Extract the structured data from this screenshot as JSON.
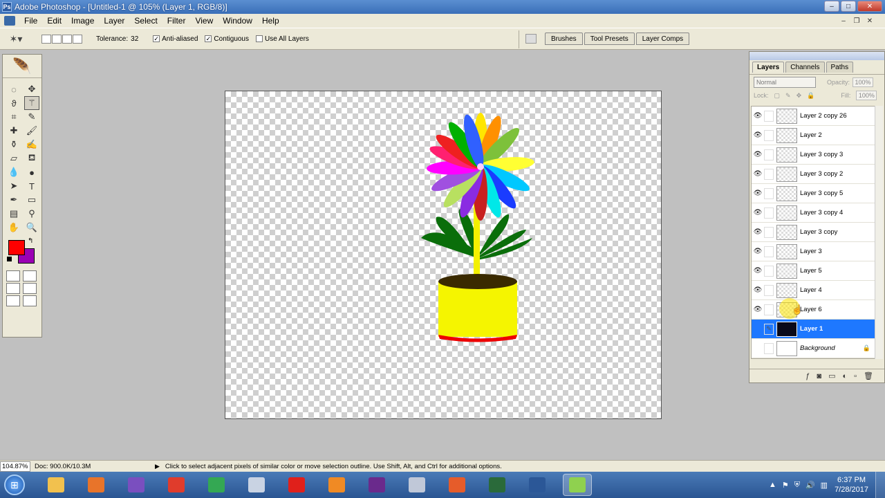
{
  "window": {
    "title": "Adobe Photoshop - [Untitled-1 @ 105% (Layer 1, RGB/8)]",
    "controls": {
      "minimize": "–",
      "maximize": "□",
      "close": "✕"
    }
  },
  "menubar": {
    "items": [
      "File",
      "Edit",
      "Image",
      "Layer",
      "Select",
      "Filter",
      "View",
      "Window",
      "Help"
    ]
  },
  "options": {
    "tolerance_label": "Tolerance:",
    "tolerance_value": "32",
    "anti_aliased": {
      "label": "Anti-aliased",
      "checked": true
    },
    "contiguous": {
      "label": "Contiguous",
      "checked": true
    },
    "use_all_layers": {
      "label": "Use All Layers",
      "checked": false
    },
    "well_tabs": [
      "Brushes",
      "Tool Presets",
      "Layer Comps"
    ]
  },
  "toolbox": {
    "foreground_color": "#ff0000",
    "background_color": "#9b00b4"
  },
  "layers_panel": {
    "tabs": [
      "Layers",
      "Channels",
      "Paths"
    ],
    "active_tab": "Layers",
    "blend_mode": "Normal",
    "opacity_label": "Opacity:",
    "opacity_value": "100%",
    "lock_label": "Lock:",
    "fill_label": "Fill:",
    "fill_value": "100%",
    "layers": [
      {
        "name": "Layer 2 copy 26",
        "visible": true,
        "selected": false
      },
      {
        "name": "Layer 2",
        "visible": true,
        "selected": false
      },
      {
        "name": "Layer 3 copy 3",
        "visible": true,
        "selected": false
      },
      {
        "name": "Layer 3 copy 2",
        "visible": true,
        "selected": false
      },
      {
        "name": "Layer 3 copy 5",
        "visible": true,
        "selected": false
      },
      {
        "name": "Layer 3 copy 4",
        "visible": true,
        "selected": false
      },
      {
        "name": "Layer 3 copy",
        "visible": true,
        "selected": false
      },
      {
        "name": "Layer 3",
        "visible": true,
        "selected": false
      },
      {
        "name": "Layer 5",
        "visible": true,
        "selected": false
      },
      {
        "name": "Layer 4",
        "visible": true,
        "selected": false
      },
      {
        "name": "Layer 6",
        "visible": true,
        "selected": false
      },
      {
        "name": "Layer 1",
        "visible": false,
        "selected": true
      },
      {
        "name": "Background",
        "visible": false,
        "selected": false,
        "locked": true
      }
    ]
  },
  "status": {
    "zoom": "104.87%",
    "doc_size": "Doc: 900.0K/10.3M",
    "hint": "Click to select adjacent pixels of similar color or move selection outline.  Use Shift, Alt, and Ctrl for additional options."
  },
  "taskbar": {
    "apps": [
      {
        "name": "explorer-icon",
        "color": "#f2c14e"
      },
      {
        "name": "media-player-icon",
        "color": "#e8742a"
      },
      {
        "name": "visual-studio-icon",
        "color": "#7a4fbf"
      },
      {
        "name": "office-icon",
        "color": "#e03c2c"
      },
      {
        "name": "chrome-icon",
        "color": "#34a853"
      },
      {
        "name": "app-icon",
        "color": "#c9d3e3"
      },
      {
        "name": "opera-icon",
        "color": "#e0201b"
      },
      {
        "name": "tasks-icon",
        "color": "#f08a24"
      },
      {
        "name": "video-icon",
        "color": "#6a2a8c"
      },
      {
        "name": "settings-icon",
        "color": "#c0c8d8"
      },
      {
        "name": "paint-icon",
        "color": "#e65c2a"
      },
      {
        "name": "terminal-icon",
        "color": "#2a6a3a"
      },
      {
        "name": "word-icon",
        "color": "#2b5797"
      },
      {
        "name": "photoshop-icon",
        "color": "#8fd14f"
      }
    ],
    "clock_time": "6:37 PM",
    "clock_date": "7/28/2017"
  }
}
